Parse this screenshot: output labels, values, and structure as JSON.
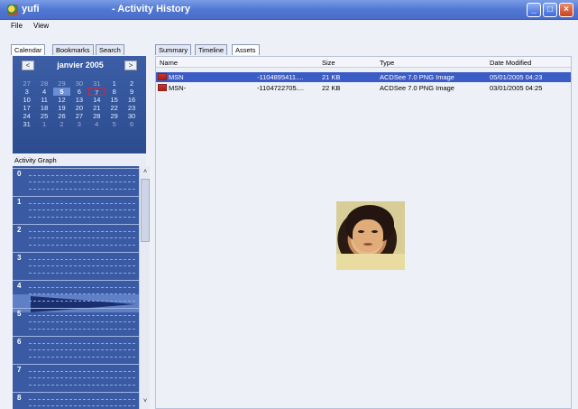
{
  "window": {
    "app_name": "yufi",
    "title": "- Activity History"
  },
  "menu": {
    "items": [
      "File",
      "View"
    ]
  },
  "left_tabs": [
    "Calendar",
    "Bookmarks",
    "Search"
  ],
  "calendar": {
    "month_label": "janvier 2005",
    "prev": "<",
    "next": ">",
    "weeks": [
      [
        "27",
        "28",
        "29",
        "30",
        "31",
        "1",
        "2"
      ],
      [
        "3",
        "4",
        "5",
        "6",
        "7",
        "8",
        "9"
      ],
      [
        "10",
        "11",
        "12",
        "13",
        "14",
        "15",
        "16"
      ],
      [
        "17",
        "18",
        "19",
        "20",
        "21",
        "22",
        "23"
      ],
      [
        "24",
        "25",
        "26",
        "27",
        "28",
        "29",
        "30"
      ],
      [
        "31",
        "1",
        "2",
        "3",
        "4",
        "5",
        "6"
      ]
    ],
    "selected_day": "5",
    "outlined_day": "7"
  },
  "activity_graph": {
    "title": "Activity Graph",
    "hours": [
      "0",
      "1",
      "2",
      "3",
      "4",
      "5",
      "6",
      "7",
      "8"
    ],
    "peak_hour": "5"
  },
  "right_tabs": [
    "Summary",
    "Timeline",
    "Assets"
  ],
  "active_right_tab": "Assets",
  "assets": {
    "columns": [
      "Name",
      "Size",
      "Type",
      "Date Modified"
    ],
    "rows": [
      {
        "name": "MSN",
        "id": "-1104895411....",
        "size": "21 KB",
        "type": "ACDSee 7.0 PNG Image",
        "date": "05/01/2005 04:23",
        "selected": true
      },
      {
        "name": "MSN-",
        "id": "-1104722705....",
        "size": "22 KB",
        "type": "ACDSee 7.0 PNG Image",
        "date": "03/01/2005 04:25",
        "selected": false
      }
    ]
  },
  "colors": {
    "titlebar": "#5178d3",
    "calendar_bg": "#2c4c8f",
    "graph_bg": "#3a5ba4",
    "selection": "#3b5cc4"
  },
  "icons": {
    "minimize": "_",
    "maximize": "□",
    "close": "×",
    "scroll_up": "˄",
    "scroll_down": "˅"
  }
}
